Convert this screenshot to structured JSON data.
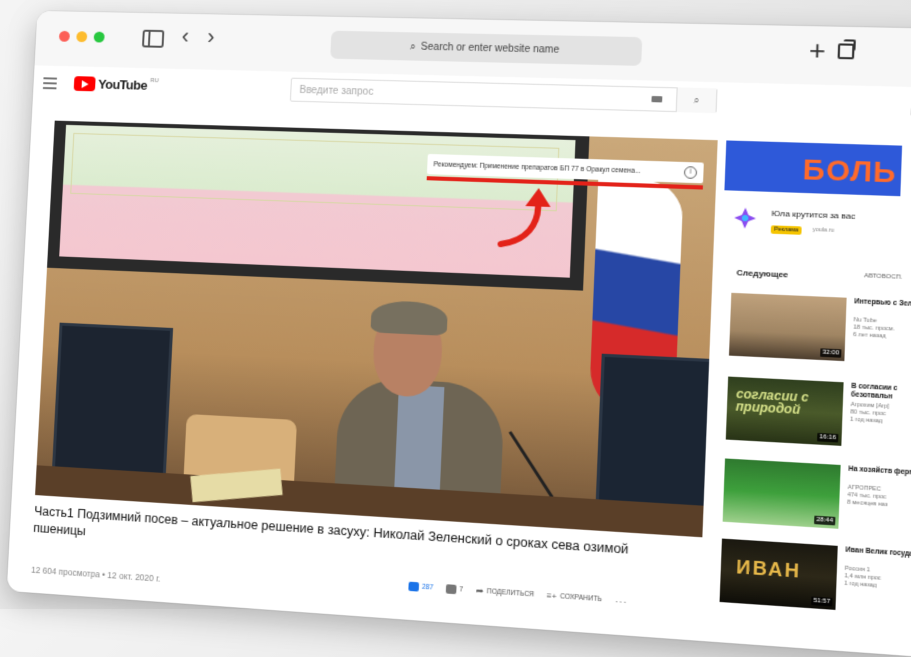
{
  "browser": {
    "url_placeholder": "Search or enter website name",
    "search_glyph": "⌕",
    "back_glyph": "‹",
    "forward_glyph": "›",
    "new_tab_glyph": "+"
  },
  "youtube": {
    "logo_text": "YouTube",
    "region": "RU",
    "search_placeholder": "Введите запрос"
  },
  "video": {
    "ad_text": "Рекомендуем: Применение препаратов БП 77 в Оракул семена...",
    "info_glyph": "i",
    "title": "Часть1 Подзимний посев – актуальное решение в засуху: Николай Зеленский о сроках сева озимой пшеницы",
    "views_date": "12 604 просмотра • 12 окт. 2020 г.",
    "likes": "287",
    "dislikes": "7",
    "share_label": "ПОДЕЛИТЬСЯ",
    "save_label": "СОХРАНИТЬ",
    "more_glyph": "···"
  },
  "sidebar": {
    "banner_text": "БОЛЬ",
    "banner_small": "",
    "promo_title": "Юла крутится за вас",
    "promo_badge": "Реклама",
    "promo_site": "youla.ru",
    "next_label": "Следующее",
    "autoplay_label": "АВТОВОСП.",
    "recommendations": [
      {
        "title": "Интервью с Зеленским",
        "meta": "Nu Tube\n18 тыс. просм.\n6 лет назад",
        "duration": "32:00",
        "thumb_text": ""
      },
      {
        "title": "В согласии с безотвальн",
        "meta": "Агрохим [Агр]\n80 тыс. прос\n1 год назад",
        "duration": "16:16",
        "thumb_text": "согласии с природой"
      },
      {
        "title": "На хозяйств фермера в",
        "meta": "АГРОПРЕС\n474 тыс. прос\n8 месяцев наз",
        "duration": "28:44",
        "thumb_text": ""
      },
      {
        "title": "Иван Велик государе",
        "meta": "Россия 1\n1,4 млн прос\n1 год назад",
        "duration": "51:57",
        "thumb_text": "ИВАН"
      }
    ]
  },
  "colors": {
    "yt_red": "#ff0000",
    "annotation_red": "#e32219",
    "link_blue": "#1a73e8",
    "banner_blue": "#2e59d9",
    "banner_orange": "#ff6a2b"
  }
}
